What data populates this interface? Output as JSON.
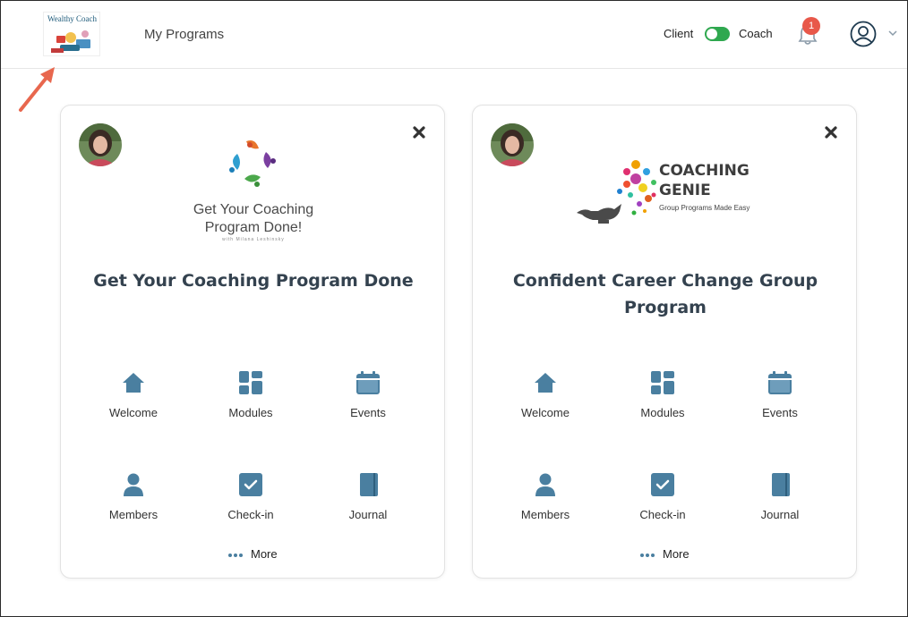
{
  "header": {
    "logo_text": "Wealthy Coach",
    "nav_title": "My Programs",
    "role_client": "Client",
    "role_coach": "Coach",
    "notification_count": "1",
    "toggle_state": "coach"
  },
  "colors": {
    "icon": "#4a7fa0",
    "toggle": "#2fa84f",
    "badge": "#e8584a",
    "arrow": "#e8674e",
    "title": "#34424f"
  },
  "programs": [
    {
      "title": "Get Your Coaching Program Done",
      "logo_line1": "Get Your Coaching",
      "logo_line2": "Program Done!",
      "logo_sub": "with Milana Leshinsky",
      "tiles": {
        "welcome": "Welcome",
        "modules": "Modules",
        "events": "Events",
        "members": "Members",
        "checkin": "Check-in",
        "journal": "Journal"
      },
      "more": "More"
    },
    {
      "title_line1": "Confident Career Change Group",
      "title_line2": "Program",
      "logo_line1": "COACHING",
      "logo_line2": "GENIE",
      "logo_sub": "Group Programs Made Easy",
      "tiles": {
        "welcome": "Welcome",
        "modules": "Modules",
        "events": "Events",
        "members": "Members",
        "checkin": "Check-in",
        "journal": "Journal"
      },
      "more": "More"
    }
  ]
}
